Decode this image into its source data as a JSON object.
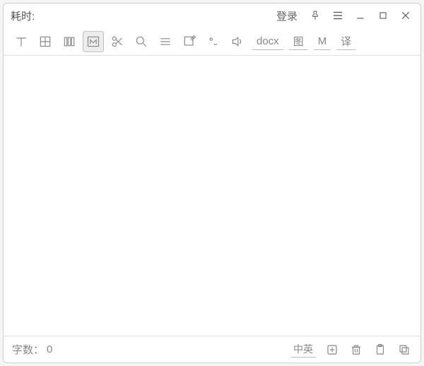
{
  "titlebar": {
    "timer_label": "耗时:",
    "timer_value": "",
    "login_label": "登录"
  },
  "toolbar": {
    "docx_label": "docx",
    "image_label": "图",
    "markdown_label": "M",
    "translate_label": "译"
  },
  "statusbar": {
    "wordcount_label": "字数：",
    "wordcount_value": "0",
    "lang_label": "中英"
  }
}
